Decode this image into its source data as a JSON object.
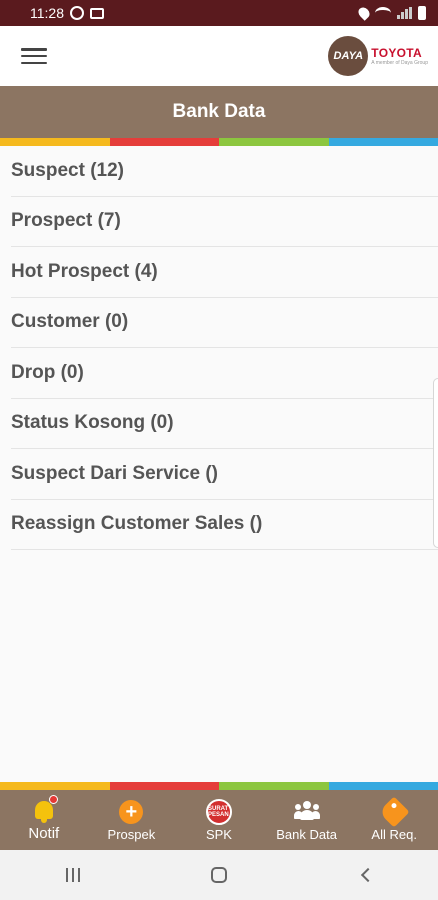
{
  "status_bar": {
    "time": "11:28"
  },
  "header": {
    "logo_badge": "DAYA",
    "logo_brand": "TOYOTA",
    "logo_sub": "A member of Daya Group"
  },
  "page": {
    "title": "Bank Data"
  },
  "stripe_colors": [
    "#f5b91d",
    "#e53d3a",
    "#8cc63f",
    "#35a9e0"
  ],
  "list": [
    {
      "label": "Suspect (12)"
    },
    {
      "label": "Prospect (7)"
    },
    {
      "label": "Hot Prospect (4)"
    },
    {
      "label": "Customer (0)"
    },
    {
      "label": "Drop (0)"
    },
    {
      "label": "Status Kosong (0)"
    },
    {
      "label": "Suspect Dari Service ()"
    },
    {
      "label": "Reassign Customer Sales ()"
    }
  ],
  "bottom_nav": [
    {
      "label": "Notif",
      "icon": "bell-icon"
    },
    {
      "label": "Prospek",
      "icon": "plus-circle-icon"
    },
    {
      "label": "SPK",
      "icon": "spk-badge-icon",
      "badge_text": "SURAT PESAN"
    },
    {
      "label": "Bank Data",
      "icon": "people-icon"
    },
    {
      "label": "All Req.",
      "icon": "tag-icon"
    }
  ],
  "colors": {
    "status_bar": "#5a1a1e",
    "brand_brown": "#8c7562",
    "text": "#555555"
  }
}
